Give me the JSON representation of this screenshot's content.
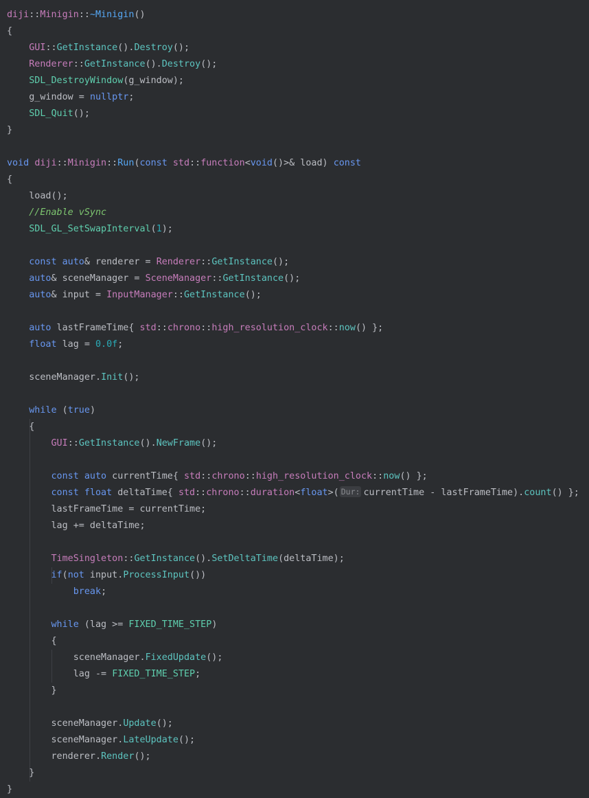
{
  "palette": {
    "background": "#2b2d30",
    "default": "#bcbec4",
    "keyword": "#6897f0",
    "namespace": "#c77dbb",
    "type": "#c77dbb",
    "function": "#56a8f5",
    "method": "#57aaf7",
    "member_fn": "#5dc5c0",
    "macro": "#5fcfae",
    "number": "#2aacb8",
    "comment": "#7ec670",
    "inlay_hint": "#8b8d92"
  },
  "code": {
    "lines": [
      [
        [
          "diji",
          "namespace"
        ],
        [
          "::",
          "default"
        ],
        [
          "Minigin",
          "namespace"
        ],
        [
          "::",
          "default"
        ],
        [
          "~Minigin",
          "function"
        ],
        [
          "()",
          "default"
        ]
      ],
      [
        [
          "{",
          "default"
        ]
      ],
      [
        [
          "    ",
          "default"
        ],
        [
          "GUI",
          "namespace"
        ],
        [
          "::",
          "default"
        ],
        [
          "GetInstance",
          "member_fn"
        ],
        [
          "().",
          "default"
        ],
        [
          "Destroy",
          "member_fn"
        ],
        [
          "();",
          "default"
        ]
      ],
      [
        [
          "    ",
          "default"
        ],
        [
          "Renderer",
          "namespace"
        ],
        [
          "::",
          "default"
        ],
        [
          "GetInstance",
          "member_fn"
        ],
        [
          "().",
          "default"
        ],
        [
          "Destroy",
          "member_fn"
        ],
        [
          "();",
          "default"
        ]
      ],
      [
        [
          "    ",
          "default"
        ],
        [
          "SDL_DestroyWindow",
          "macro"
        ],
        [
          "(g_window);",
          "default"
        ]
      ],
      [
        [
          "    ",
          "default"
        ],
        [
          "g_window = ",
          "default"
        ],
        [
          "nullptr",
          "keyword"
        ],
        [
          ";",
          "default"
        ]
      ],
      [
        [
          "    ",
          "default"
        ],
        [
          "SDL_Quit",
          "macro"
        ],
        [
          "();",
          "default"
        ]
      ],
      [
        [
          "}",
          "default"
        ]
      ],
      [],
      [
        [
          "void",
          "keyword"
        ],
        [
          " ",
          "default"
        ],
        [
          "diji",
          "namespace"
        ],
        [
          "::",
          "default"
        ],
        [
          "Minigin",
          "namespace"
        ],
        [
          "::",
          "default"
        ],
        [
          "Run",
          "function"
        ],
        [
          "(",
          "default"
        ],
        [
          "const",
          "keyword"
        ],
        [
          " ",
          "default"
        ],
        [
          "std",
          "namespace"
        ],
        [
          "::",
          "default"
        ],
        [
          "function",
          "namespace"
        ],
        [
          "<",
          "default"
        ],
        [
          "void",
          "keyword"
        ],
        [
          "()>& load) ",
          "default"
        ],
        [
          "const",
          "keyword"
        ]
      ],
      [
        [
          "{",
          "default"
        ]
      ],
      [
        [
          "    ",
          "default"
        ],
        [
          "load();",
          "default"
        ]
      ],
      [
        [
          "    ",
          "default"
        ],
        [
          "//Enable vSync",
          "comment"
        ]
      ],
      [
        [
          "    ",
          "default"
        ],
        [
          "SDL_GL_SetSwapInterval",
          "macro"
        ],
        [
          "(",
          "default"
        ],
        [
          "1",
          "number"
        ],
        [
          ");",
          "default"
        ]
      ],
      [],
      [
        [
          "    ",
          "default"
        ],
        [
          "const",
          "keyword"
        ],
        [
          " ",
          "default"
        ],
        [
          "auto",
          "keyword"
        ],
        [
          "& renderer = ",
          "default"
        ],
        [
          "Renderer",
          "namespace"
        ],
        [
          "::",
          "default"
        ],
        [
          "GetInstance",
          "member_fn"
        ],
        [
          "();",
          "default"
        ]
      ],
      [
        [
          "    ",
          "default"
        ],
        [
          "auto",
          "keyword"
        ],
        [
          "& sceneManager = ",
          "default"
        ],
        [
          "SceneManager",
          "namespace"
        ],
        [
          "::",
          "default"
        ],
        [
          "GetInstance",
          "member_fn"
        ],
        [
          "();",
          "default"
        ]
      ],
      [
        [
          "    ",
          "default"
        ],
        [
          "auto",
          "keyword"
        ],
        [
          "& input = ",
          "default"
        ],
        [
          "InputManager",
          "namespace"
        ],
        [
          "::",
          "default"
        ],
        [
          "GetInstance",
          "member_fn"
        ],
        [
          "();",
          "default"
        ]
      ],
      [],
      [
        [
          "    ",
          "default"
        ],
        [
          "auto",
          "keyword"
        ],
        [
          " lastFrameTime{ ",
          "default"
        ],
        [
          "std",
          "namespace"
        ],
        [
          "::",
          "default"
        ],
        [
          "chrono",
          "namespace"
        ],
        [
          "::",
          "default"
        ],
        [
          "high_resolution_clock",
          "namespace"
        ],
        [
          "::",
          "default"
        ],
        [
          "now",
          "member_fn"
        ],
        [
          "() };",
          "default"
        ]
      ],
      [
        [
          "    ",
          "default"
        ],
        [
          "float",
          "keyword"
        ],
        [
          " lag = ",
          "default"
        ],
        [
          "0.0f",
          "number"
        ],
        [
          ";",
          "default"
        ]
      ],
      [],
      [
        [
          "    ",
          "default"
        ],
        [
          "sceneManager.",
          "default"
        ],
        [
          "Init",
          "member_fn"
        ],
        [
          "();",
          "default"
        ]
      ],
      [],
      [
        [
          "    ",
          "default"
        ],
        [
          "while",
          "keyword"
        ],
        [
          " (",
          "default"
        ],
        [
          "true",
          "keyword"
        ],
        [
          ")",
          "default"
        ]
      ],
      [
        [
          "    ",
          "default"
        ],
        [
          "{",
          "default"
        ]
      ],
      [
        [
          "        ",
          "default"
        ],
        [
          "GUI",
          "namespace"
        ],
        [
          "::",
          "default"
        ],
        [
          "GetInstance",
          "member_fn"
        ],
        [
          "().",
          "default"
        ],
        [
          "NewFrame",
          "member_fn"
        ],
        [
          "();",
          "default"
        ]
      ],
      [],
      [
        [
          "        ",
          "default"
        ],
        [
          "const",
          "keyword"
        ],
        [
          " ",
          "default"
        ],
        [
          "auto",
          "keyword"
        ],
        [
          " currentTime{ ",
          "default"
        ],
        [
          "std",
          "namespace"
        ],
        [
          "::",
          "default"
        ],
        [
          "chrono",
          "namespace"
        ],
        [
          "::",
          "default"
        ],
        [
          "high_resolution_clock",
          "namespace"
        ],
        [
          "::",
          "default"
        ],
        [
          "now",
          "member_fn"
        ],
        [
          "() };",
          "default"
        ]
      ],
      [
        [
          "        ",
          "default"
        ],
        [
          "const",
          "keyword"
        ],
        [
          " ",
          "default"
        ],
        [
          "float",
          "keyword"
        ],
        [
          " deltaTime{ ",
          "default"
        ],
        [
          "std",
          "namespace"
        ],
        [
          "::",
          "default"
        ],
        [
          "chrono",
          "namespace"
        ],
        [
          "::",
          "default"
        ],
        [
          "duration",
          "namespace"
        ],
        [
          "<",
          "default"
        ],
        [
          "float",
          "keyword"
        ],
        [
          ">(",
          "default"
        ],
        [
          "Dur:",
          "inlay_hint"
        ],
        [
          "currentTime - lastFrameTime).",
          "default"
        ],
        [
          "count",
          "member_fn"
        ],
        [
          "() };",
          "default"
        ]
      ],
      [
        [
          "        ",
          "default"
        ],
        [
          "lastFrameTime = currentTime;",
          "default"
        ]
      ],
      [
        [
          "        ",
          "default"
        ],
        [
          "lag += deltaTime;",
          "default"
        ]
      ],
      [],
      [
        [
          "        ",
          "default"
        ],
        [
          "TimeSingleton",
          "namespace"
        ],
        [
          "::",
          "default"
        ],
        [
          "GetInstance",
          "member_fn"
        ],
        [
          "().",
          "default"
        ],
        [
          "SetDeltaTime",
          "member_fn"
        ],
        [
          "(deltaTime);",
          "default"
        ]
      ],
      [
        [
          "        ",
          "default"
        ],
        [
          "if",
          "keyword"
        ],
        [
          "(",
          "default"
        ],
        [
          "not",
          "keyword"
        ],
        [
          " input.",
          "default"
        ],
        [
          "ProcessInput",
          "member_fn"
        ],
        [
          "())",
          "default"
        ]
      ],
      [
        [
          "            ",
          "default"
        ],
        [
          "break",
          "keyword"
        ],
        [
          ";",
          "default"
        ]
      ],
      [],
      [
        [
          "        ",
          "default"
        ],
        [
          "while",
          "keyword"
        ],
        [
          " (lag >= ",
          "default"
        ],
        [
          "FIXED_TIME_STEP",
          "macro"
        ],
        [
          ")",
          "default"
        ]
      ],
      [
        [
          "        ",
          "default"
        ],
        [
          "{",
          "default"
        ]
      ],
      [
        [
          "            ",
          "default"
        ],
        [
          "sceneManager.",
          "default"
        ],
        [
          "FixedUpdate",
          "member_fn"
        ],
        [
          "();",
          "default"
        ]
      ],
      [
        [
          "            ",
          "default"
        ],
        [
          "lag -= ",
          "default"
        ],
        [
          "FIXED_TIME_STEP",
          "macro"
        ],
        [
          ";",
          "default"
        ]
      ],
      [
        [
          "        ",
          "default"
        ],
        [
          "}",
          "default"
        ]
      ],
      [],
      [
        [
          "        ",
          "default"
        ],
        [
          "sceneManager.",
          "default"
        ],
        [
          "Update",
          "member_fn"
        ],
        [
          "();",
          "default"
        ]
      ],
      [
        [
          "        ",
          "default"
        ],
        [
          "sceneManager.",
          "default"
        ],
        [
          "LateUpdate",
          "member_fn"
        ],
        [
          "();",
          "default"
        ]
      ],
      [
        [
          "        ",
          "default"
        ],
        [
          "renderer.",
          "default"
        ],
        [
          "Render",
          "member_fn"
        ],
        [
          "();",
          "default"
        ]
      ],
      [
        [
          "    ",
          "default"
        ],
        [
          "}",
          "default"
        ]
      ],
      [
        [
          "}",
          "default"
        ]
      ]
    ]
  }
}
